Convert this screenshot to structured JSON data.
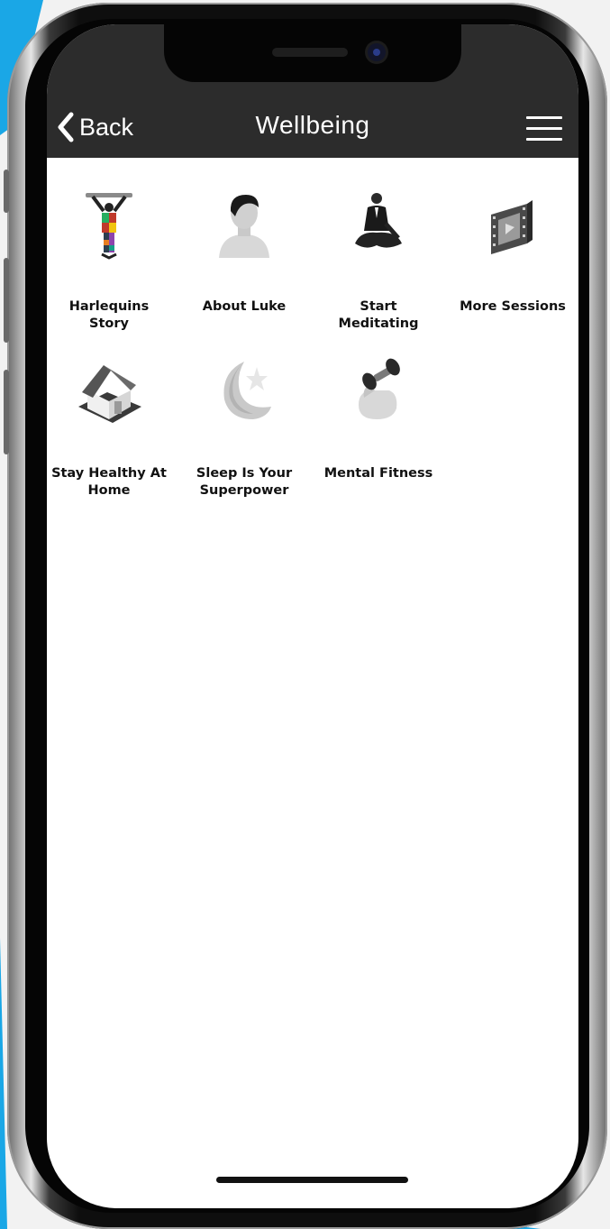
{
  "header": {
    "back_label": "Back",
    "title": "Wellbeing"
  },
  "tiles": [
    {
      "label": "Harlequins\nStory",
      "icon": "harlequin-figure-icon"
    },
    {
      "label": "About Luke",
      "icon": "person-profile-icon"
    },
    {
      "label": "Start\nMeditating",
      "icon": "meditation-icon"
    },
    {
      "label": "More Sessions",
      "icon": "film-strip-icon"
    },
    {
      "label": "Stay Healthy At\nHome",
      "icon": "house-icon"
    },
    {
      "label": "Sleep Is Your\nSuperpower",
      "icon": "moon-star-icon"
    },
    {
      "label": "Mental Fitness",
      "icon": "dumbbell-icon"
    }
  ],
  "colors": {
    "header_bg": "#2c2c2c",
    "header_text": "#ffffff",
    "accent_background": "#1aa7e6",
    "screen_bg": "#ffffff"
  }
}
